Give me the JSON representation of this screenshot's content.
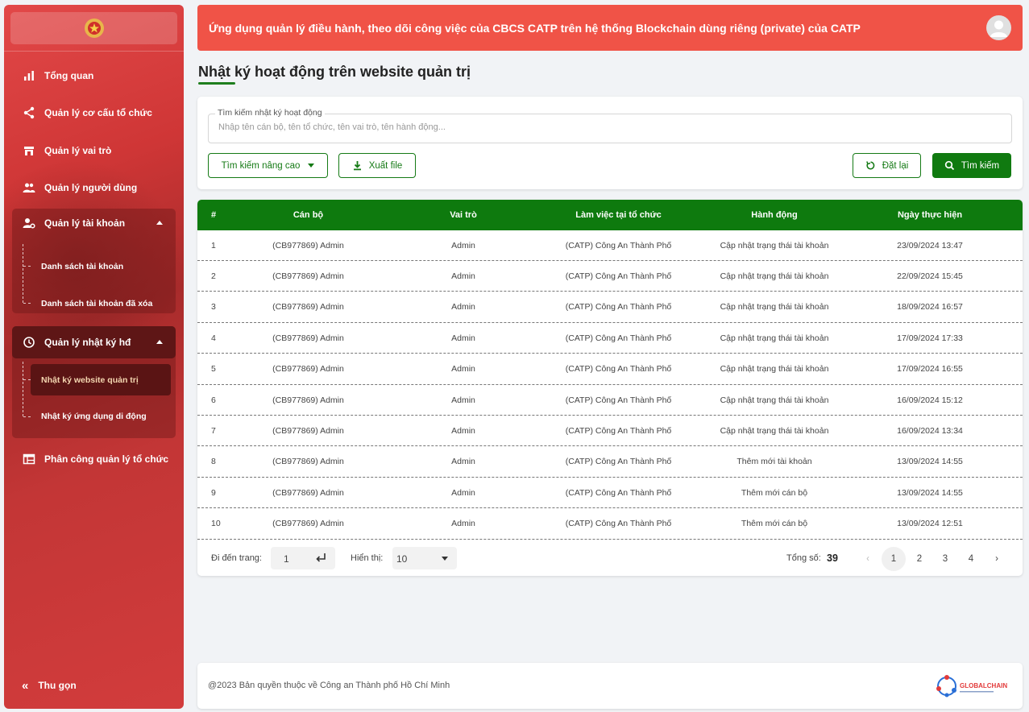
{
  "sidebar": {
    "items": [
      {
        "label": "Tổng quan",
        "icon": "chart-bar-icon"
      },
      {
        "label": "Quản lý cơ cấu tổ chức",
        "icon": "share-icon"
      },
      {
        "label": "Quản lý vai trò",
        "icon": "store-icon"
      },
      {
        "label": "Quản lý người dùng",
        "icon": "people-icon"
      }
    ],
    "account_group": {
      "label": "Quản lý tài khoản",
      "icon": "user-settings-icon",
      "children": [
        "Danh sách tài khoản",
        "Danh sách tài khoản đã xóa"
      ]
    },
    "log_group": {
      "label": "Quản lý nhật ký hđ",
      "icon": "history-icon",
      "children": [
        "Nhật ký website quản trị",
        "Nhật ký ứng dụng di động"
      ],
      "active_child": "Nhật ký website quản trị"
    },
    "assign_item": {
      "label": "Phân công quản lý tổ chức",
      "icon": "table-icon"
    },
    "collapse_label": "Thu gọn"
  },
  "header": {
    "title": "Ứng dụng quản lý điều hành, theo dõi công việc của CBCS CATP trên hệ thống Blockchain dùng riêng (private) của CATP"
  },
  "page": {
    "title": "Nhật ký hoạt động trên website quản trị"
  },
  "search": {
    "label": "Tìm kiếm nhật ký hoạt động",
    "placeholder": "Nhập tên cán bộ, tên tổ chức, tên vai trò, tên hành động...",
    "advanced_label": "Tìm kiếm nâng cao",
    "export_label": "Xuất file",
    "reset_label": "Đặt lại",
    "search_label": "Tìm kiếm"
  },
  "table": {
    "headers": [
      "#",
      "Cán bộ",
      "Vai trò",
      "Làm việc tại tổ chức",
      "Hành động",
      "Ngày thực hiện"
    ],
    "rows": [
      [
        "1",
        "(CB977869) Admin",
        "Admin",
        "(CATP) Công An Thành Phố",
        "Cập nhật trạng thái tài khoản",
        "23/09/2024 13:47"
      ],
      [
        "2",
        "(CB977869) Admin",
        "Admin",
        "(CATP) Công An Thành Phố",
        "Cập nhật trạng thái tài khoản",
        "22/09/2024 15:45"
      ],
      [
        "3",
        "(CB977869) Admin",
        "Admin",
        "(CATP) Công An Thành Phố",
        "Cập nhật trạng thái tài khoản",
        "18/09/2024 16:57"
      ],
      [
        "4",
        "(CB977869) Admin",
        "Admin",
        "(CATP) Công An Thành Phố",
        "Cập nhật trạng thái tài khoản",
        "17/09/2024 17:33"
      ],
      [
        "5",
        "(CB977869) Admin",
        "Admin",
        "(CATP) Công An Thành Phố",
        "Cập nhật trạng thái tài khoản",
        "17/09/2024 16:55"
      ],
      [
        "6",
        "(CB977869) Admin",
        "Admin",
        "(CATP) Công An Thành Phố",
        "Cập nhật trạng thái tài khoản",
        "16/09/2024 15:12"
      ],
      [
        "7",
        "(CB977869) Admin",
        "Admin",
        "(CATP) Công An Thành Phố",
        "Cập nhật trạng thái tài khoản",
        "16/09/2024 13:34"
      ],
      [
        "8",
        "(CB977869) Admin",
        "Admin",
        "(CATP) Công An Thành Phố",
        "Thêm mới tài khoản",
        "13/09/2024 14:55"
      ],
      [
        "9",
        "(CB977869) Admin",
        "Admin",
        "(CATP) Công An Thành Phố",
        "Thêm mới cán bộ",
        "13/09/2024 14:55"
      ],
      [
        "10",
        "(CB977869) Admin",
        "Admin",
        "(CATP) Công An Thành Phố",
        "Thêm mới cán bộ",
        "13/09/2024 12:51"
      ]
    ]
  },
  "pagination": {
    "goto_label": "Đi đến trang:",
    "goto_value": "1",
    "show_label": "Hiển thị:",
    "show_value": "10",
    "total_label": "Tổng số:",
    "total_value": "39",
    "pages": [
      "1",
      "2",
      "3",
      "4"
    ],
    "current_page": "1"
  },
  "footer": {
    "copyright": "@2023 Bản quyền thuộc về Công an Thành phố Hồ Chí Minh",
    "brand_logo": "GLOBALCHAIN"
  },
  "colors": {
    "primary_green": "#0e7a0e",
    "header_red": "#f05347",
    "sidebar_red": "#cf3636"
  }
}
